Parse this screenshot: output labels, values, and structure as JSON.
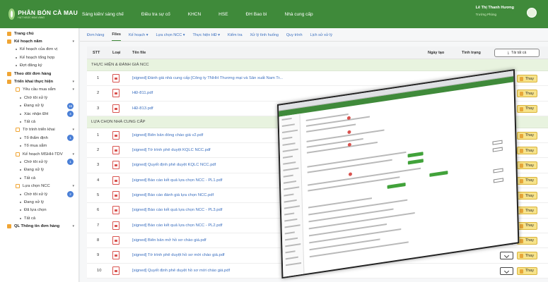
{
  "brand": {
    "name": "PHÂN BÓN CÀ MAU",
    "tagline": "HẠT NGỌC MÙA VÀNG"
  },
  "topnav": [
    "Sáng kiến/ sáng chế",
    "Điều tra sự cố",
    "KHCN",
    "HSE",
    "ĐH Bao bì",
    "Nhà cung cấp"
  ],
  "user": {
    "name": "Lê Thị Thanh Hương",
    "role": "Trưởng Phòng"
  },
  "sidebar": [
    {
      "label": "Trang chủ",
      "level": 0,
      "icon": "home-icon"
    },
    {
      "label": "Kế hoạch năm",
      "level": 0,
      "icon": "plan-icon",
      "chevron": "▾"
    },
    {
      "label": "Kế hoạch của đơn vị",
      "level": 1,
      "bullet": true
    },
    {
      "label": "Kế hoạch tổng hợp",
      "level": 1,
      "bullet": true
    },
    {
      "label": "Đợt đăng ký",
      "level": 1,
      "bullet": true
    },
    {
      "label": "Theo dõi đơn hàng",
      "level": 0,
      "icon": "order-icon"
    },
    {
      "label": "Triển khai thực hiện",
      "level": 0,
      "icon": "deploy-icon",
      "chevron": "▾"
    },
    {
      "label": "Yêu cầu mua sắm",
      "level": 1,
      "icon": "list-icon",
      "chevron": "▾"
    },
    {
      "label": "Chờ tôi xử lý",
      "level": 2,
      "bullet": true
    },
    {
      "label": "Đang xử lý",
      "level": 2,
      "bullet": true,
      "badge": "16"
    },
    {
      "label": "Xác nhận ĐH",
      "level": 2,
      "bullet": true,
      "badge": "4"
    },
    {
      "label": "Tất cả",
      "level": 2,
      "bullet": true
    },
    {
      "label": "Tờ trình triển khai",
      "level": 1,
      "icon": "list-icon",
      "chevron": "▾"
    },
    {
      "label": "Tổ thẩm định",
      "level": 2,
      "bullet": true,
      "badge": "1"
    },
    {
      "label": "Tổ mua sắm",
      "level": 2,
      "bullet": true
    },
    {
      "label": "Kế hoạch MSHH-TDV",
      "level": 1,
      "icon": "list-icon",
      "chevron": "▾"
    },
    {
      "label": "Chờ tôi xử lý",
      "level": 2,
      "bullet": true,
      "badge": "1"
    },
    {
      "label": "Đang xử lý",
      "level": 2,
      "bullet": true
    },
    {
      "label": "Tất cả",
      "level": 2,
      "bullet": true
    },
    {
      "label": "Lựa chọn NCC",
      "level": 1,
      "icon": "list-icon",
      "chevron": "▾"
    },
    {
      "label": "Chờ tôi xử lý",
      "level": 2,
      "bullet": true,
      "badge": "2"
    },
    {
      "label": "Đang xử lý",
      "level": 2,
      "bullet": true
    },
    {
      "label": "Đã lựa chọn",
      "level": 2,
      "bullet": true
    },
    {
      "label": "Tất cả",
      "level": 2,
      "bullet": true
    },
    {
      "label": "QL Thông tin đơn hàng",
      "level": 0,
      "icon": "info-icon",
      "chevron": "▾"
    }
  ],
  "tabs": [
    {
      "label": "Đơn hàng",
      "active": false
    },
    {
      "label": "Files",
      "active": true
    },
    {
      "label": "Kế hoạch ▾",
      "active": false
    },
    {
      "label": "Lựa chọn NCC ▾",
      "active": false
    },
    {
      "label": "Thực hiện HĐ ▾",
      "active": false
    },
    {
      "label": "Kiểm tra",
      "active": false
    },
    {
      "label": "Xử lý tình huống",
      "active": false
    },
    {
      "label": "Quy trình",
      "active": false
    },
    {
      "label": "Lịch sử xử lý",
      "active": false
    }
  ],
  "table": {
    "headers": {
      "stt": "STT",
      "loai": "Loại",
      "ten": "Tên file",
      "ngay": "Ngày tạo",
      "tinh": "Tình trạng"
    },
    "download_all": "Tải tất cả",
    "replace_label": "Thay",
    "groups": [
      {
        "title": "THỰC HIỆN & ĐÁNH GIÁ NCC",
        "rows": [
          {
            "stt": "1",
            "name": "[signed] Đánh giá nhà cung cấp [Công ty TNHH Thương mại và Sản xuất Nam Tr..."
          },
          {
            "stt": "2",
            "name": "HĐ-811.pdf"
          },
          {
            "stt": "3",
            "name": "HĐ-813.pdf"
          }
        ]
      },
      {
        "title": "LỰA CHỌN NHÀ CUNG CẤP",
        "rows": [
          {
            "stt": "1",
            "name": "[signed] Biên bản đóng chào giá v2.pdf"
          },
          {
            "stt": "2",
            "name": "[signed] Tờ trình phê duyệt KQLC NCC.pdf"
          },
          {
            "stt": "3",
            "name": "[signed] Quyết định phê duyệt KQLC NCC.pdf"
          },
          {
            "stt": "4",
            "name": "[signed] Báo cáo kết quả lựa chọn NCC - PL1.pdf"
          },
          {
            "stt": "5",
            "name": "[signed] Báo cáo đánh giá lựa chọn NCC.pdf"
          },
          {
            "stt": "6",
            "name": "[signed] Báo cáo kết quả lựa chọn NCC - PL3.pdf"
          },
          {
            "stt": "7",
            "name": "[signed] Báo cáo kết quả lựa chọn NCC - PL2.pdf"
          },
          {
            "stt": "8",
            "name": "[signed] Biên bản mở hồ sơ chào giá.pdf"
          },
          {
            "stt": "9",
            "name": "[signed] Tờ trình phê duyệt hồ sơ mời chào giá.pdf"
          },
          {
            "stt": "10",
            "name": "[signed] Quyết định phê duyệt hồ sơ mời chào giá.pdf"
          }
        ]
      }
    ]
  }
}
